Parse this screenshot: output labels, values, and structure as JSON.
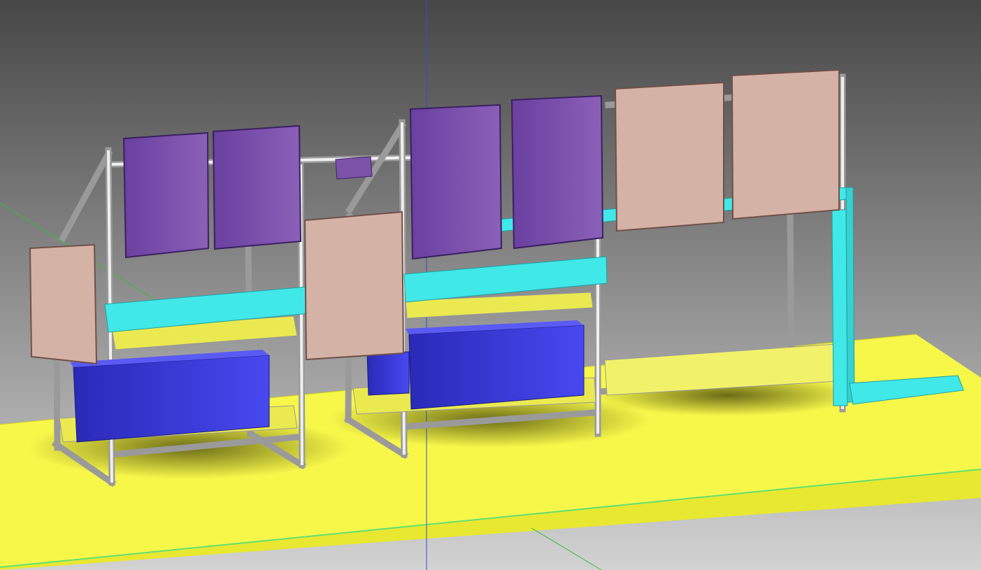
{
  "scene": {
    "type": "3d-cad-viewport",
    "colors": {
      "background_top": "#474747",
      "background_bottom": "#cfcfcf",
      "floor": "#f7f74a",
      "inverter": "#7b52a8",
      "enclosure": "#d4b2a6",
      "cable_tray": "#40e8e8",
      "battery": "#3a3ae0",
      "frame": "#e0e0e0",
      "axis_vertical": "#3050c0",
      "axis_horizontal": "#30c030"
    }
  }
}
